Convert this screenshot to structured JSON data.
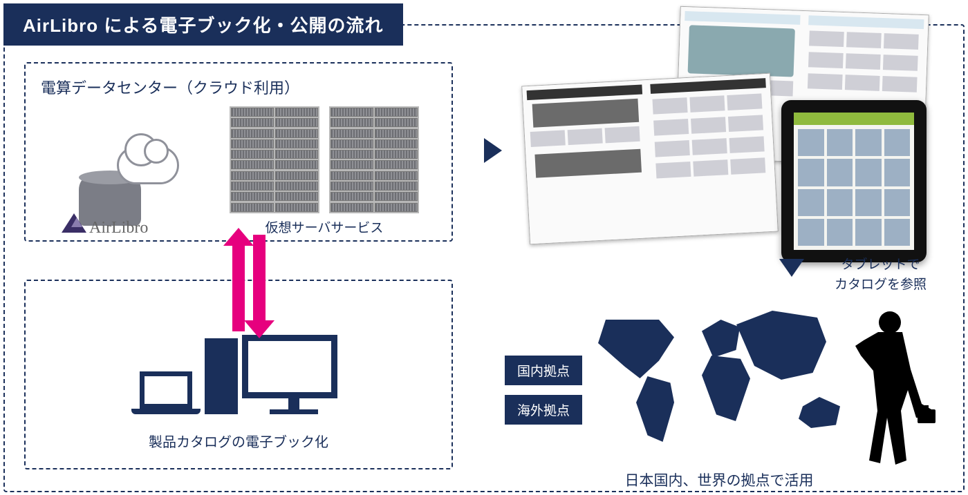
{
  "title": "AirLibro による電子ブック化・公開の流れ",
  "datacenter": {
    "heading": "電算データセンター（クラウド利用）",
    "logo_text": "AirLibro",
    "server_label": "仮想サーバサービス"
  },
  "client": {
    "label": "製品カタログの電子ブック化"
  },
  "tablet": {
    "line1": "タブレットで",
    "line2": "カタログを参照"
  },
  "locations": {
    "domestic": "国内拠点",
    "overseas": "海外拠点",
    "usage": "日本国内、世界の拠点で活用"
  },
  "colors": {
    "primary": "#1a2f5a",
    "accent": "#e6007e"
  }
}
